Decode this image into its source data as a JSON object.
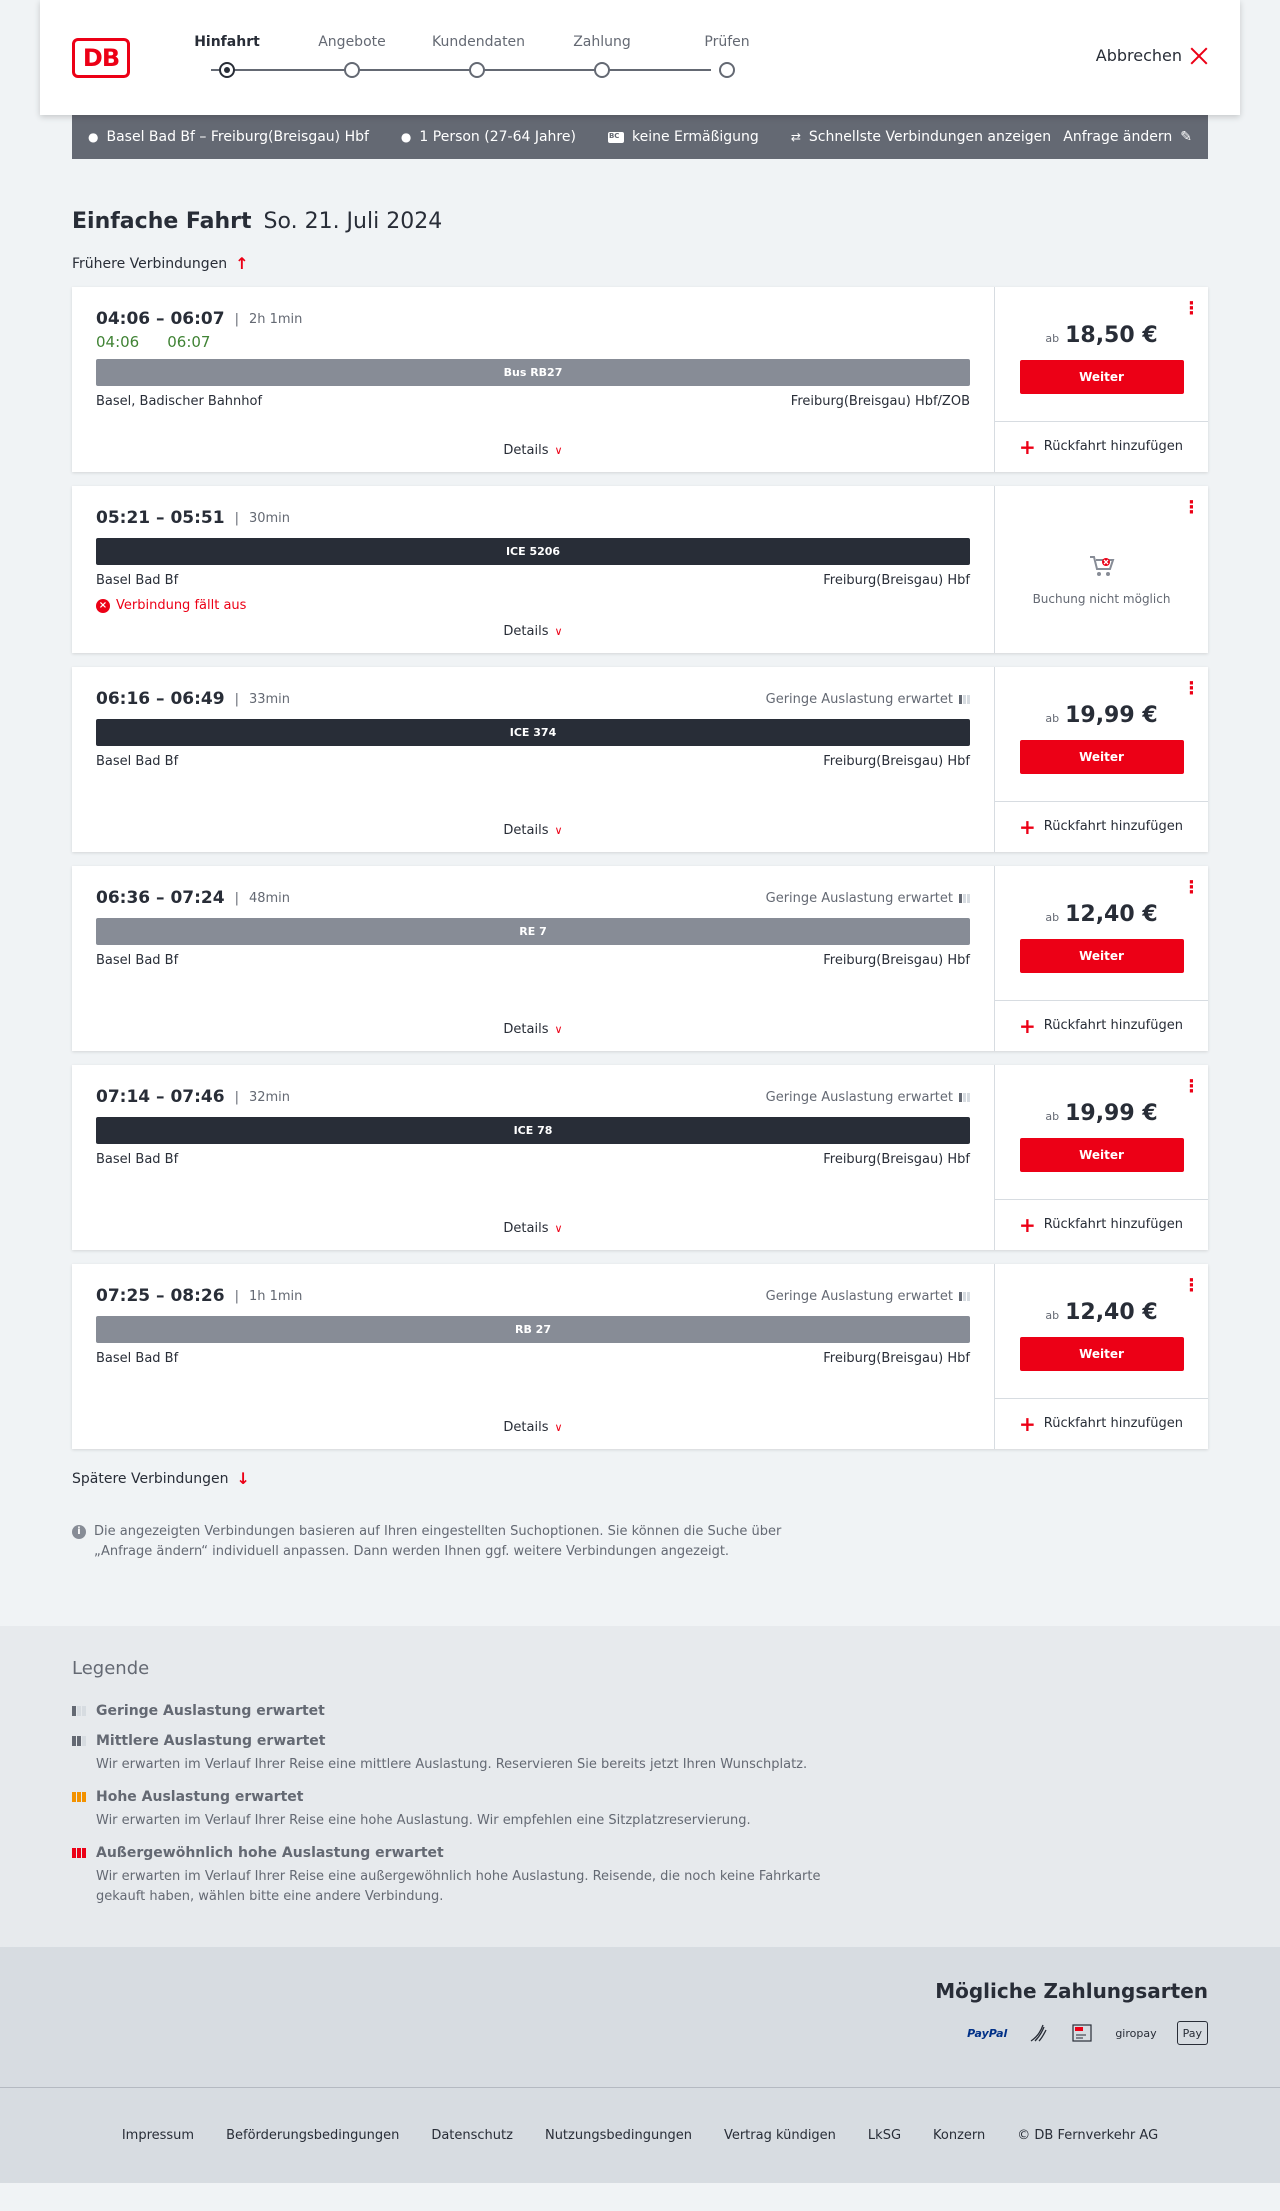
{
  "header": {
    "logo": "DB",
    "steps": [
      {
        "label": "Hinfahrt",
        "active": true
      },
      {
        "label": "Angebote",
        "active": false
      },
      {
        "label": "Kundendaten",
        "active": false
      },
      {
        "label": "Zahlung",
        "active": false
      },
      {
        "label": "Prüfen",
        "active": false
      }
    ],
    "cancel_label": "Abbrechen"
  },
  "query": {
    "route": "Basel Bad Bf – Freiburg(Breisgau) Hbf",
    "persons": "1 Person (27-64 Jahre)",
    "discount": "keine Ermäßigung",
    "fastest": "Schnellste Verbindungen anzeigen",
    "change": "Anfrage ändern"
  },
  "trip": {
    "type": "Einfache Fahrt",
    "date": "So. 21. Juli 2024",
    "earlier": "Frühere Verbindungen",
    "later": "Spätere Verbindungen"
  },
  "labels": {
    "details": "Details",
    "weiter": "Weiter",
    "return": "Rückfahrt hinzufügen",
    "ab": "ab",
    "no_booking": "Buchung nicht möglich",
    "cancelled": "Verbindung fällt aus"
  },
  "connections": [
    {
      "times": "04:06 – 06:07",
      "duration": "2h 1min",
      "rt_dep": "04:06",
      "rt_arr": "06:07",
      "train": "Bus RB27",
      "from": "Basel, Badischer Bahnhof",
      "to": "Freiburg(Breisgau) Hbf/ZOB",
      "price": "18,50 €",
      "load": ""
    },
    {
      "times": "05:21 – 05:51",
      "duration": "30min",
      "train": "ICE 5206",
      "from": "Basel Bad Bf",
      "to": "Freiburg(Breisgau) Hbf",
      "price": "",
      "load": ""
    },
    {
      "times": "06:16 – 06:49",
      "duration": "33min",
      "train": "ICE 374",
      "from": "Basel Bad Bf",
      "to": "Freiburg(Breisgau) Hbf",
      "price": "19,99 €",
      "load": "Geringe Auslastung erwartet"
    },
    {
      "times": "06:36 – 07:24",
      "duration": "48min",
      "train": "RE 7",
      "from": "Basel Bad Bf",
      "to": "Freiburg(Breisgau) Hbf",
      "price": "12,40 €",
      "load": "Geringe Auslastung erwartet"
    },
    {
      "times": "07:14 – 07:46",
      "duration": "32min",
      "train": "ICE 78",
      "from": "Basel Bad Bf",
      "to": "Freiburg(Breisgau) Hbf",
      "price": "19,99 €",
      "load": "Geringe Auslastung erwartet"
    },
    {
      "times": "07:25 – 08:26",
      "duration": "1h 1min",
      "train": "RB 27",
      "from": "Basel Bad Bf",
      "to": "Freiburg(Breisgau) Hbf",
      "price": "12,40 €",
      "load": "Geringe Auslastung erwartet"
    }
  ],
  "info_note": "Die angezeigten Verbindungen basieren auf Ihren eingestellten Suchoptionen. Sie können die Suche über „Anfrage ändern“ individuell anpassen. Dann werden Ihnen ggf. weitere Verbindungen angezeigt.",
  "legend": {
    "title": "Legende",
    "items": [
      {
        "title": "Geringe Auslastung erwartet",
        "desc": ""
      },
      {
        "title": "Mittlere Auslastung erwartet",
        "desc": "Wir erwarten im Verlauf Ihrer Reise eine mittlere Auslastung. Reservieren Sie bereits jetzt Ihren Wunschplatz."
      },
      {
        "title": "Hohe Auslastung erwartet",
        "desc": "Wir erwarten im Verlauf Ihrer Reise eine hohe Auslastung. Wir empfehlen eine Sitzplatzreservierung."
      },
      {
        "title": "Außergewöhnlich hohe Auslastung erwartet",
        "desc": "Wir erwarten im Verlauf Ihrer Reise eine außergewöhnlich hohe Auslastung. Reisende, die noch keine Fahrkarte gekauft haben, wählen bitte eine andere Verbindung."
      }
    ]
  },
  "payments": {
    "title": "Mögliche Zahlungsarten",
    "methods": [
      "PayPal",
      "giropay",
      "Pay"
    ]
  },
  "footer": {
    "links": [
      "Impressum",
      "Beförderungsbedingungen",
      "Datenschutz",
      "Nutzungsbedingungen",
      "Vertrag kündigen",
      "LkSG",
      "Konzern",
      "© DB Fernverkehr AG"
    ]
  },
  "colors": {
    "brand_red": "#ec0016",
    "realtime_green": "#408335",
    "dark": "#282d37",
    "grey": "#646973"
  }
}
